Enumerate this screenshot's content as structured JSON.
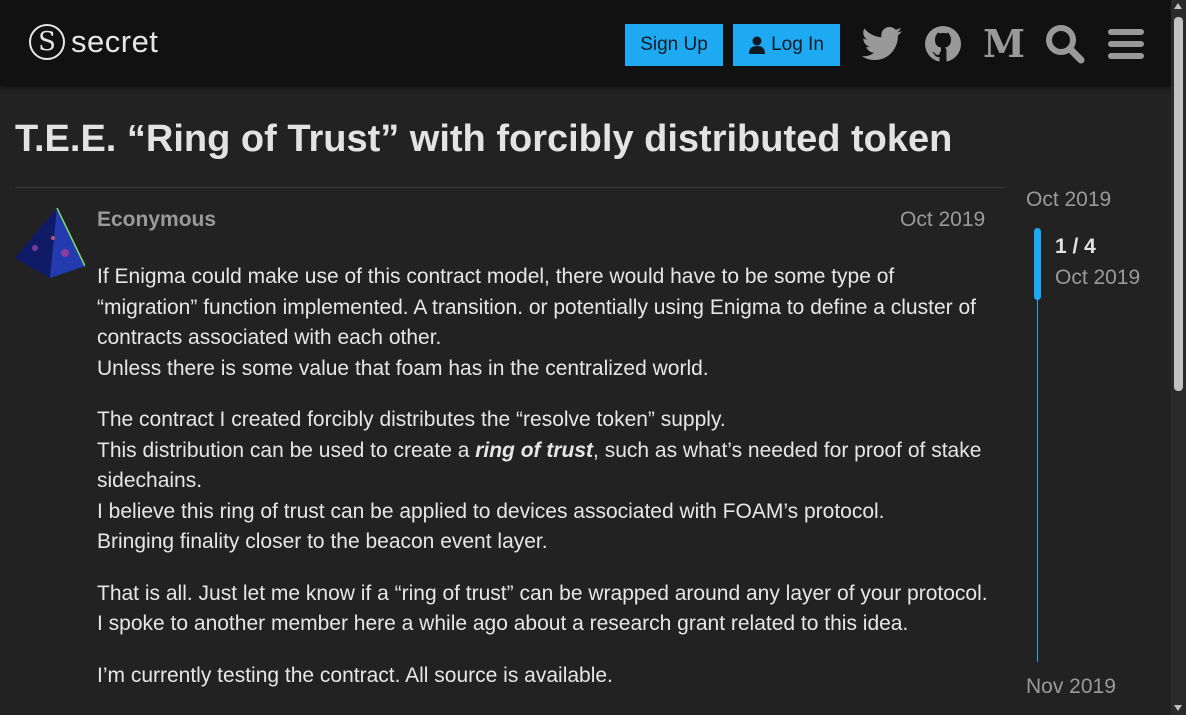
{
  "header": {
    "logo_text": "secret",
    "signup_label": "Sign Up",
    "login_label": "Log In",
    "icons": [
      "twitter-icon",
      "github-icon",
      "medium-icon",
      "search-icon",
      "hamburger-menu-icon"
    ]
  },
  "topic": {
    "title": "T.E.E. “Ring of Trust” with forcibly distributed token"
  },
  "post": {
    "username": "Econymous",
    "date": "Oct 2019",
    "paragraphs": [
      {
        "l1": "If Enigma could make use of this contract model, there would have to be some type of “migration” function implemented. A transition. or potentially using Enigma to define a cluster of contracts associated with each other.",
        "l2": "Unless there is some value that foam has in the centralized world."
      },
      {
        "l1": "The contract I created forcibly distributes the “resolve token” supply.",
        "l2a": "This distribution can be used to create a ",
        "l2b": "ring of trust",
        "l2c": ", such as what’s needed for proof of stake sidechains.",
        "l3": "I believe this ring of trust can be applied to devices associated with FOAM’s protocol.",
        "l4": "Bringing finality closer to the beacon event layer."
      },
      {
        "l1": "That is all. Just let me know if a “ring of trust” can be wrapped around any layer of your protocol.",
        "l2": "I spoke to another member here a while ago about a research grant related to this idea."
      },
      {
        "l1": "I’m currently testing the contract. All source is available."
      }
    ]
  },
  "timeline": {
    "start_date": "Oct 2019",
    "position": "1 / 4",
    "position_date": "Oct 2019",
    "end_date": "Nov 2019"
  },
  "colors": {
    "accent": "#1eaaf2",
    "background": "#222222",
    "header_bg": "#111111"
  }
}
